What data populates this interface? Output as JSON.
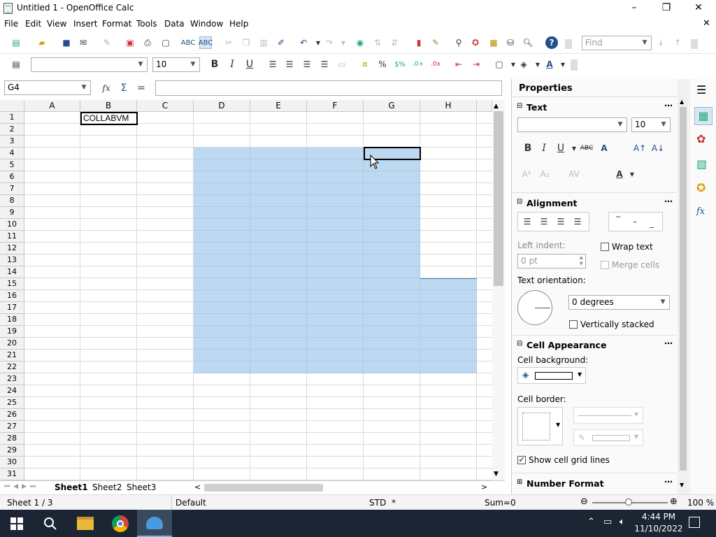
{
  "window": {
    "title": "Untitled 1 - OpenOffice Calc",
    "minimize": "–",
    "maximize": "❐",
    "close": "✕",
    "doc_close": "✕"
  },
  "menus": [
    "File",
    "Edit",
    "View",
    "Insert",
    "Format",
    "Tools",
    "Data",
    "Window",
    "Help"
  ],
  "toolbar": {
    "find_placeholder": "Find",
    "font_name": "",
    "font_size": "10"
  },
  "formula": {
    "cell_ref": "G4",
    "content": ""
  },
  "grid": {
    "columns": [
      "A",
      "B",
      "C",
      "D",
      "E",
      "F",
      "G",
      "H"
    ],
    "rows": [
      "1",
      "2",
      "3",
      "4",
      "5",
      "6",
      "7",
      "8",
      "9",
      "10",
      "11",
      "12",
      "13",
      "14",
      "15",
      "16",
      "17",
      "18",
      "19",
      "20",
      "21",
      "22",
      "23",
      "24",
      "25",
      "26",
      "27",
      "28",
      "29",
      "30",
      "31"
    ],
    "cell_b1": "COLLABVM",
    "active_cell": "G4"
  },
  "sheets": [
    "Sheet1",
    "Sheet2",
    "Sheet3"
  ],
  "status": {
    "sheet": "Sheet 1 / 3",
    "style": "Default",
    "mode": "STD",
    "modified": "*",
    "sum": "Sum=0",
    "zoom": "100 %"
  },
  "sidebar": {
    "title": "Properties",
    "text_section": "Text",
    "font_size": "10",
    "alignment_section": "Alignment",
    "left_indent_label": "Left indent:",
    "left_indent_value": "0 pt",
    "wrap_text": "Wrap text",
    "merge_cells": "Merge cells",
    "text_orientation_label": "Text orientation:",
    "orientation_value": "0 degrees",
    "vertically_stacked": "Vertically stacked",
    "cell_appearance_section": "Cell Appearance",
    "cell_background_label": "Cell background:",
    "cell_border_label": "Cell border:",
    "show_grid_lines": "Show cell grid lines",
    "number_format_section": "Number Format"
  },
  "taskbar": {
    "time": "4:44 PM",
    "date": "11/10/2022"
  },
  "colors": {
    "selection": "#91bee8",
    "taskbar": "#1b2533",
    "accent": "#0078d7"
  }
}
